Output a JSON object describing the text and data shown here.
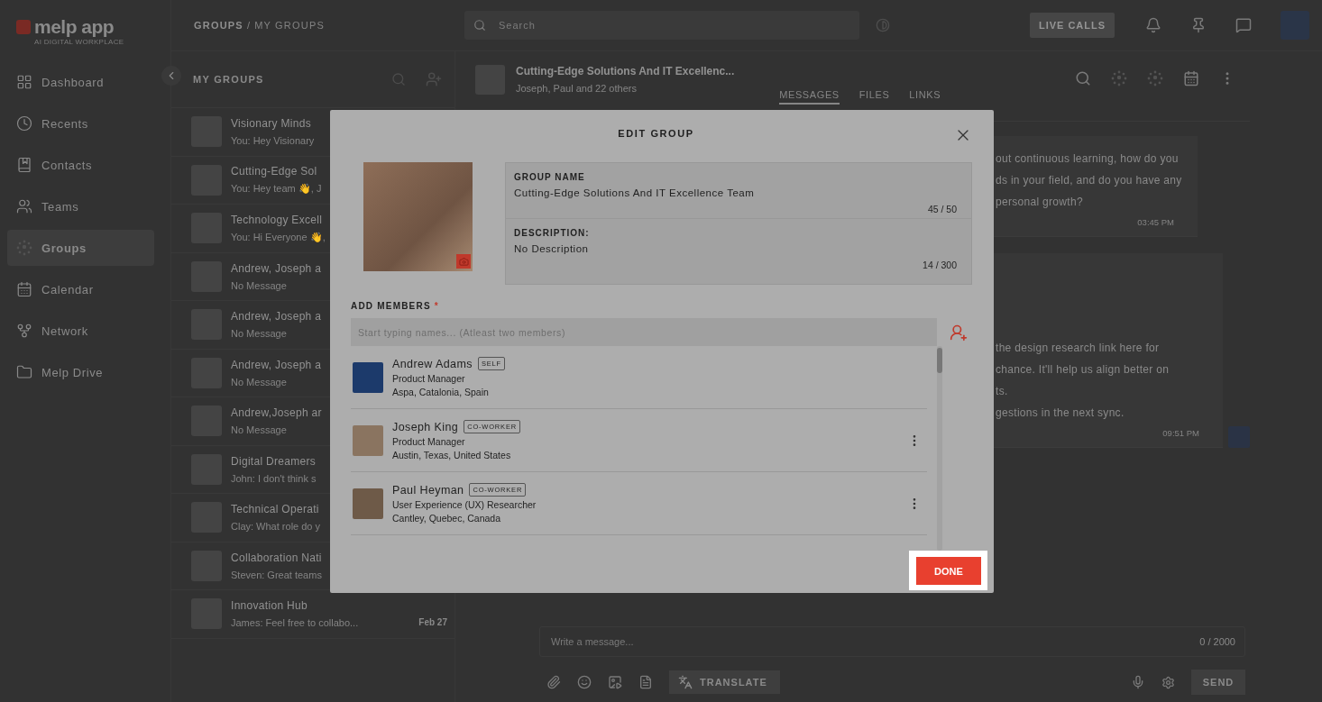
{
  "app": {
    "logo": "melp app",
    "tagline": "AI DIGITAL WORKPLACE"
  },
  "sidebar": {
    "items": [
      {
        "label": "Dashboard",
        "selected": false
      },
      {
        "label": "Recents",
        "selected": false
      },
      {
        "label": "Contacts",
        "selected": false
      },
      {
        "label": "Teams",
        "selected": false
      },
      {
        "label": "Groups",
        "selected": true
      },
      {
        "label": "Calendar",
        "selected": false
      },
      {
        "label": "Network",
        "selected": false
      },
      {
        "label": "Melp Drive",
        "selected": false
      }
    ]
  },
  "header": {
    "breadcrumb": {
      "section": "GROUPS",
      "separator": "/",
      "page": "MY GROUPS"
    },
    "search": {
      "placeholder": "Search"
    },
    "live_calls": "LIVE CALLS"
  },
  "groups_panel": {
    "title": "MY GROUPS",
    "groups": [
      {
        "name": "Visionary Minds",
        "preview": "You: Hey Visionary"
      },
      {
        "name": "Cutting-Edge Sol",
        "preview": "You: Hey team 👋, J"
      },
      {
        "name": "Technology Excell",
        "preview": "You: Hi Everyone 👋,"
      },
      {
        "name": "Andrew, Joseph a",
        "preview": "No Message"
      },
      {
        "name": "Andrew, Joseph a",
        "preview": "No Message"
      },
      {
        "name": "Andrew, Joseph a",
        "preview": "No Message"
      },
      {
        "name": "Andrew,Joseph ar",
        "preview": "No Message"
      },
      {
        "name": "Digital Dreamers",
        "preview": "John: I don't think s"
      },
      {
        "name": "Technical Operati",
        "preview": "Clay: What role do y"
      },
      {
        "name": "Collaboration Nati",
        "preview": "Steven: Great teams"
      },
      {
        "name": "Innovation Hub",
        "preview": "James: Feel free to collabo...",
        "date": "Feb 27"
      }
    ]
  },
  "chat": {
    "title": "Cutting-Edge Solutions And IT Excellenc...",
    "subtitle": "Joseph, Paul and 22 others",
    "tabs": [
      {
        "label": "MESSAGES",
        "selected": true
      },
      {
        "label": "FILES",
        "selected": false
      },
      {
        "label": "LINKS",
        "selected": false
      }
    ],
    "messages": [
      {
        "lines": [
          "out continuous learning, how do you",
          "ds in your field, and do you have any",
          "personal growth?"
        ],
        "time": "03:45 PM"
      },
      {
        "lines": [
          "the design research link here for",
          "chance. It'll help us align better on",
          "ts.",
          "gestions in the next sync."
        ],
        "time": "09:51 PM"
      }
    ],
    "composer": {
      "placeholder": "Write a message...",
      "counter": "0 / 2000",
      "translate": "TRANSLATE",
      "send": "SEND"
    }
  },
  "modal": {
    "title": "EDIT GROUP",
    "group_name": {
      "label": "GROUP NAME",
      "value": "Cutting-Edge Solutions And IT Excellence Team",
      "counter": "45 / 50"
    },
    "description": {
      "label": "DESCRIPTION:",
      "value": "No Description",
      "counter": "14 / 300"
    },
    "add_members": {
      "label": "ADD MEMBERS",
      "required": "*",
      "placeholder": "Start typing names... (Atleast two members)"
    },
    "members": [
      {
        "name": "Andrew Adams",
        "badge": "SELF",
        "role": "Product Manager",
        "location": "Aspa, Catalonia, Spain",
        "actions": false
      },
      {
        "name": "Joseph King",
        "badge": "CO-WORKER",
        "role": "Product Manager",
        "location": "Austin, Texas, United States",
        "actions": true
      },
      {
        "name": "Paul Heyman",
        "badge": "CO-WORKER",
        "role": "User Experience (UX) Researcher",
        "location": "Cantley, Quebec, Canada",
        "actions": true
      }
    ],
    "done": "DONE"
  }
}
